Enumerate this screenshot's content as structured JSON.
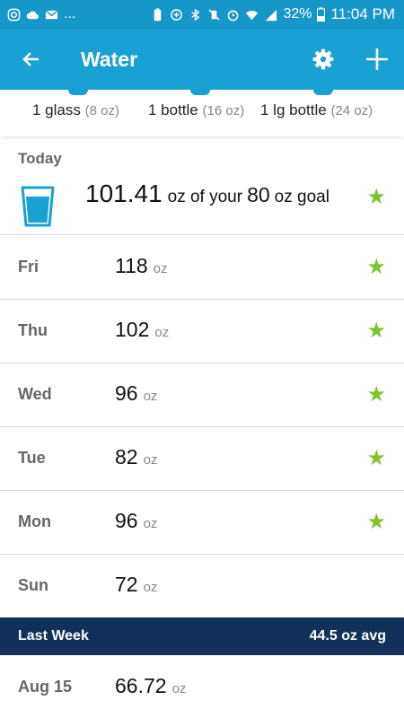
{
  "status_bar": {
    "left_dots": "...",
    "battery": "32%",
    "time": "11:04 PM"
  },
  "header": {
    "title": "Water"
  },
  "quick_add": [
    {
      "label": "1 glass",
      "sub": "(8 oz)"
    },
    {
      "label": "1 bottle",
      "sub": "(16 oz)"
    },
    {
      "label": "1 lg bottle",
      "sub": "(24 oz)"
    }
  ],
  "today": {
    "label": "Today",
    "amount": "101.41",
    "text_mid": "oz of your",
    "goal": "80",
    "text_end": "oz goal",
    "goal_met": true
  },
  "days": [
    {
      "day": "Fri",
      "value": "118",
      "unit": "oz",
      "star": true
    },
    {
      "day": "Thu",
      "value": "102",
      "unit": "oz",
      "star": true
    },
    {
      "day": "Wed",
      "value": "96",
      "unit": "oz",
      "star": true
    },
    {
      "day": "Tue",
      "value": "82",
      "unit": "oz",
      "star": true
    },
    {
      "day": "Mon",
      "value": "96",
      "unit": "oz",
      "star": true
    },
    {
      "day": "Sun",
      "value": "72",
      "unit": "oz",
      "star": false
    }
  ],
  "last_week": {
    "label": "Last Week",
    "avg": "44.5 oz avg"
  },
  "weeks": [
    {
      "day": "Aug 15",
      "value": "66.72",
      "unit": "oz"
    }
  ],
  "icons": {
    "star": "★"
  },
  "colors": {
    "app_bar": "#1aa1d4",
    "status_bar": "#1597c8",
    "star": "#7fc42e",
    "section_header": "#12305a"
  }
}
